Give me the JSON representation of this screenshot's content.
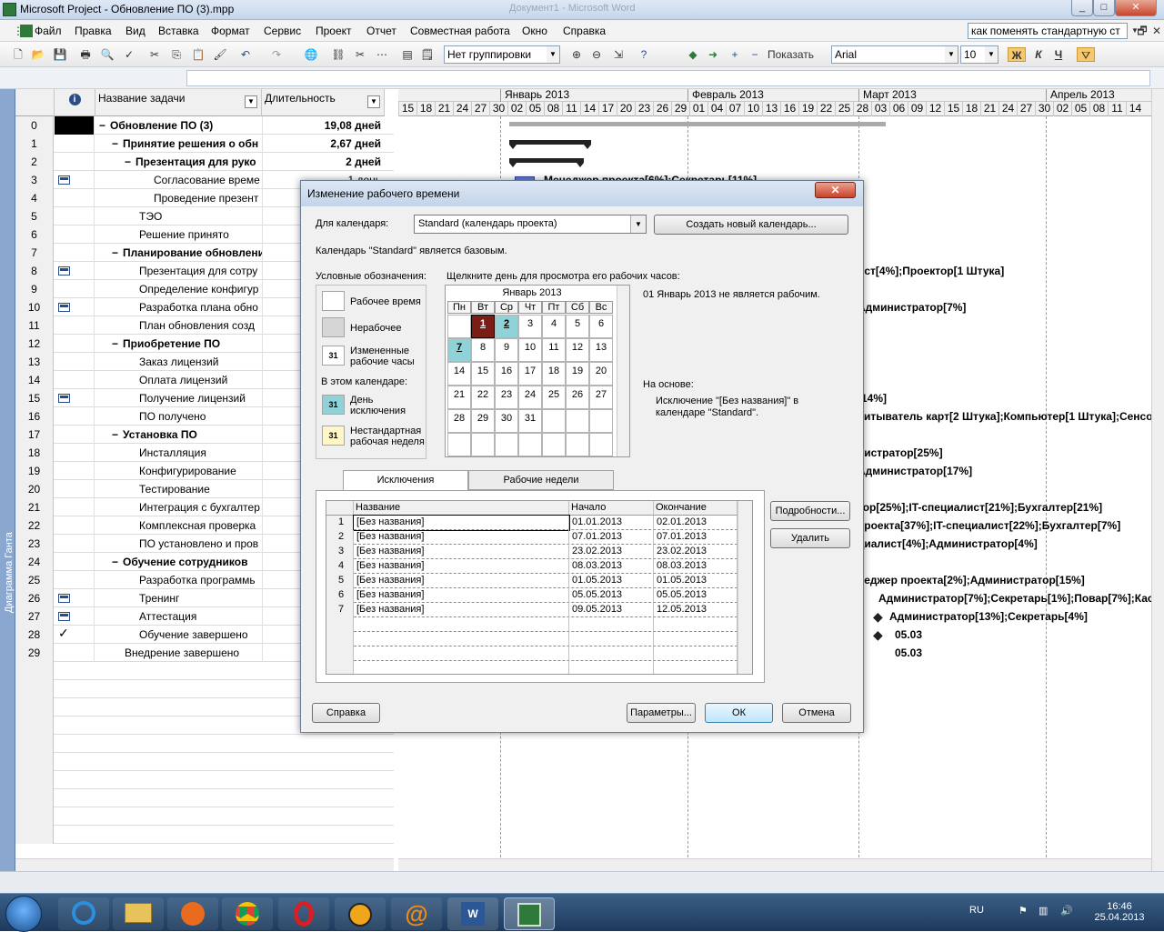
{
  "window": {
    "title": "Microsoft Project - Обновление ПО (3).mpp",
    "ghost_title": "Документ1 - Microsoft Word",
    "min": "_",
    "max": "□",
    "close": "✕"
  },
  "menu": [
    "Файл",
    "Правка",
    "Вид",
    "Вставка",
    "Формат",
    "Сервис",
    "Проект",
    "Отчет",
    "Совместная работа",
    "Окно",
    "Справка"
  ],
  "help_search": "как поменять стандартную ст",
  "toolbar": {
    "grouping": "Нет группировки",
    "show": "Показать",
    "font": "Arial",
    "size": "10",
    "bold": "Ж",
    "italic": "К",
    "underline": "Ч"
  },
  "table": {
    "headers": {
      "info": "i",
      "name": "Название задачи",
      "duration": "Длительность"
    },
    "rows": [
      {
        "id": "0",
        "name": "Обновление ПО (3)",
        "dur": "19,08 дней",
        "level": 0,
        "bold": true,
        "summary": true
      },
      {
        "id": "1",
        "name": "Принятие решения о обн",
        "dur": "2,67 дней",
        "level": 1,
        "bold": true,
        "summary": true
      },
      {
        "id": "2",
        "name": "Презентация для руко",
        "dur": "2 дней",
        "level": 2,
        "bold": true,
        "summary": true
      },
      {
        "id": "3",
        "name": "Согласование време",
        "dur": "1 день",
        "level": 3,
        "icon": true
      },
      {
        "id": "4",
        "name": "Проведение презент",
        "dur": "",
        "level": 3
      },
      {
        "id": "5",
        "name": "ТЭО",
        "dur": "",
        "level": 2
      },
      {
        "id": "6",
        "name": "Решение принято",
        "dur": "",
        "level": 2
      },
      {
        "id": "7",
        "name": "Планирование обновлени",
        "dur": "",
        "level": 1,
        "bold": true,
        "summary": true
      },
      {
        "id": "8",
        "name": "Презентация для сотру",
        "dur": "",
        "level": 2,
        "icon": true
      },
      {
        "id": "9",
        "name": "Определение конфигур",
        "dur": "",
        "level": 2
      },
      {
        "id": "10",
        "name": "Разработка плана обно",
        "dur": "",
        "level": 2,
        "icon": true
      },
      {
        "id": "11",
        "name": "План обновления созд",
        "dur": "",
        "level": 2
      },
      {
        "id": "12",
        "name": "Приобретение ПО",
        "dur": "",
        "level": 1,
        "bold": true,
        "summary": true
      },
      {
        "id": "13",
        "name": "Заказ лицензий",
        "dur": "",
        "level": 2
      },
      {
        "id": "14",
        "name": "Оплата лицензий",
        "dur": "",
        "level": 2
      },
      {
        "id": "15",
        "name": "Получение лицензий",
        "dur": "",
        "level": 2,
        "icon": true
      },
      {
        "id": "16",
        "name": "ПО получено",
        "dur": "",
        "level": 2
      },
      {
        "id": "17",
        "name": "Установка ПО",
        "dur": "",
        "level": 1,
        "bold": true,
        "summary": true
      },
      {
        "id": "18",
        "name": "Инсталляция",
        "dur": "",
        "level": 2
      },
      {
        "id": "19",
        "name": "Конфигурирование",
        "dur": "",
        "level": 2
      },
      {
        "id": "20",
        "name": "Тестирование",
        "dur": "",
        "level": 2
      },
      {
        "id": "21",
        "name": "Интеграция с бухгалтер",
        "dur": "",
        "level": 2
      },
      {
        "id": "22",
        "name": "Комплексная проверка",
        "dur": "",
        "level": 2
      },
      {
        "id": "23",
        "name": "ПО установлено и пров",
        "dur": "",
        "level": 2
      },
      {
        "id": "24",
        "name": "Обучение сотрудников",
        "dur": "",
        "level": 1,
        "bold": true,
        "summary": true
      },
      {
        "id": "25",
        "name": "Разработка программь",
        "dur": "",
        "level": 2
      },
      {
        "id": "26",
        "name": "Тренинг",
        "dur": "",
        "level": 2,
        "icon": true
      },
      {
        "id": "27",
        "name": "Аттестация",
        "dur": "",
        "level": 2,
        "icon": true
      },
      {
        "id": "28",
        "name": "Обучение завершено",
        "dur": "",
        "level": 2,
        "check": true
      },
      {
        "id": "29",
        "name": "Внедрение завершено",
        "dur": "",
        "level": 1
      }
    ]
  },
  "gantt": {
    "months": [
      "Январь 2013",
      "Февраль 2013",
      "Март 2013",
      "Апрель 2013"
    ],
    "days": [
      "15",
      "18",
      "21",
      "24",
      "27",
      "30",
      "02",
      "05",
      "08",
      "11",
      "14",
      "17",
      "20",
      "23",
      "26",
      "29",
      "01",
      "04",
      "07",
      "10",
      "13",
      "16",
      "19",
      "22",
      "25",
      "28",
      "03",
      "06",
      "09",
      "12",
      "15",
      "18",
      "21",
      "24",
      "27",
      "30",
      "02",
      "05",
      "08",
      "11",
      "14"
    ],
    "labels": [
      {
        "row": 3,
        "text": "Менеджер проекта[6%];Секретарь[11%]"
      },
      {
        "row": 8,
        "text": "ист[4%];Проектор[1 Штука]"
      },
      {
        "row": 10,
        "text": "Администратор[7%]"
      },
      {
        "row": 15,
        "text": "[14%]"
      },
      {
        "row": 16,
        "text": "читыватель карт[2 Штука];Компьютер[1 Штука];Сенсо"
      },
      {
        "row": 18,
        "text": "нистратор[25%]"
      },
      {
        "row": 19,
        "text": "Администратор[17%]"
      },
      {
        "row": 21,
        "text": "тор[25%];IT-специалист[21%];Бухгалтер[21%]"
      },
      {
        "row": 22,
        "text": "проекта[37%];IT-специалист[22%];Бухгалтер[7%]"
      },
      {
        "row": 23,
        "text": "циалист[4%];Администратор[4%]"
      },
      {
        "row": 25,
        "text": "неджер проекта[2%];Администратор[15%]"
      },
      {
        "row": 26,
        "text": "Администратор[7%];Секретарь[1%];Повар[7%];Касс"
      },
      {
        "row": 27,
        "text": "Администратор[13%];Секретарь[4%]"
      },
      {
        "row": 28,
        "text": "05.03"
      },
      {
        "row": 29,
        "text": "05.03"
      }
    ]
  },
  "view_bar": "Диаграмма Ганта",
  "dialog": {
    "title": "Изменение рабочего времени",
    "for_calendar_label": "Для календаря:",
    "calendar_value": "Standard (календарь проекта)",
    "new_calendar_btn": "Создать новый календарь...",
    "base_info": "Календарь \"Standard\" является базовым.",
    "legend_title": "Условные обозначения:",
    "legend": {
      "working": "Рабочее время",
      "nonworking": "Нерабочее",
      "changed": "Измененные рабочие часы",
      "in_calendar": "В этом календаре:",
      "exception": "День исключения",
      "nondefault": "Нестандартная рабочая неделя",
      "sample_day": "31"
    },
    "click_hint": "Щелкните день для просмотра его рабочих часов:",
    "month_title": "Январь 2013",
    "dow": [
      "Пн",
      "Вт",
      "Ср",
      "Чт",
      "Пт",
      "Сб",
      "Вс"
    ],
    "day_info": "01 Январь 2013 не является рабочим.",
    "based_on_label": "На основе:",
    "based_on_text": "Исключение \"[Без названия]\" в календаре \"Standard\".",
    "tabs": [
      "Исключения",
      "Рабочие недели"
    ],
    "grid_headers": [
      "Название",
      "Начало",
      "Окончание"
    ],
    "exceptions": [
      {
        "n": "1",
        "name": "[Без названия]",
        "start": "01.01.2013",
        "end": "02.01.2013"
      },
      {
        "n": "2",
        "name": "[Без названия]",
        "start": "07.01.2013",
        "end": "07.01.2013"
      },
      {
        "n": "3",
        "name": "[Без названия]",
        "start": "23.02.2013",
        "end": "23.02.2013"
      },
      {
        "n": "4",
        "name": "[Без названия]",
        "start": "08.03.2013",
        "end": "08.03.2013"
      },
      {
        "n": "5",
        "name": "[Без названия]",
        "start": "01.05.2013",
        "end": "01.05.2013"
      },
      {
        "n": "6",
        "name": "[Без названия]",
        "start": "05.05.2013",
        "end": "05.05.2013"
      },
      {
        "n": "7",
        "name": "[Без названия]",
        "start": "09.05.2013",
        "end": "12.05.2013"
      }
    ],
    "details_btn": "Подробности...",
    "delete_btn": "Удалить",
    "help_btn": "Справка",
    "options_btn": "Параметры...",
    "ok_btn": "ОК",
    "cancel_btn": "Отмена"
  },
  "taskbar": {
    "lang": "RU",
    "time": "16:46",
    "date": "25.04.2013"
  }
}
